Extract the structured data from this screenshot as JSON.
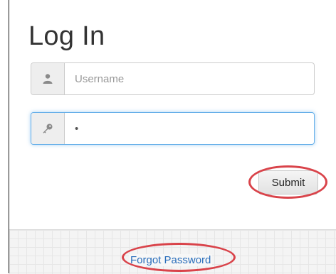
{
  "form": {
    "title": "Log In",
    "username": {
      "placeholder": "Username",
      "value": "",
      "icon": "user-icon"
    },
    "password": {
      "value": "•",
      "icon": "key-icon"
    },
    "submit_label": "Submit",
    "forgot_label": "Forgot Password"
  },
  "colors": {
    "highlight": "#d9434a",
    "link": "#2a6ebb",
    "focus": "#66afe9"
  }
}
